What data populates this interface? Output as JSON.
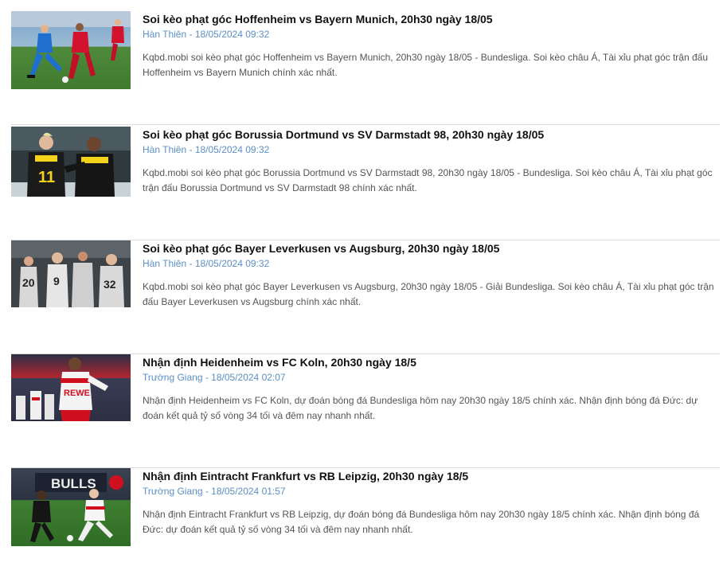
{
  "articles": [
    {
      "title": "Soi kèo phạt góc Hoffenheim vs Bayern Munich, 20h30 ngày 18/05",
      "author": "Hàn Thiên",
      "date": "18/05/2024 09:32",
      "excerpt": "Kqbd.mobi soi kèo phạt góc Hoffenheim vs Bayern Munich, 20h30 ngày 18/05 - Bundesliga. Soi kèo châu Á, Tài xỉu phạt góc trận đấu Hoffenheim vs Bayern Munich chính xác nhất.",
      "thumbnail": "hoffenheim-bayern-match-photo"
    },
    {
      "title": "Soi kèo phạt góc Borussia Dortmund vs SV Darmstadt 98, 20h30 ngày 18/05",
      "author": "Hàn Thiên",
      "date": "18/05/2024 09:32",
      "excerpt": "Kqbd.mobi soi kèo phạt góc Borussia Dortmund vs SV Darmstadt 98, 20h30 ngày 18/05 - Bundesliga. Soi kèo châu Á, Tài xỉu phạt góc trận đấu Borussia Dortmund vs SV Darmstadt 98 chính xác nhất.",
      "thumbnail": "dortmund-players-photo"
    },
    {
      "title": "Soi kèo phạt góc Bayer Leverkusen vs Augsburg, 20h30 ngày 18/05",
      "author": "Hàn Thiên",
      "date": "18/05/2024 09:32",
      "excerpt": "Kqbd.mobi soi kèo phạt góc Bayer Leverkusen vs Augsburg, 20h30 ngày 18/05 - Giải Bundesliga. Soi kèo châu Á, Tài xỉu phạt góc trận đấu Bayer Leverkusen vs Augsburg chính xác nhất.",
      "thumbnail": "leverkusen-celebration-photo"
    },
    {
      "title": "Nhận định Heidenheim vs FC Koln, 20h30 ngày 18/5",
      "author": "Trường Giang",
      "date": "18/05/2024 02:07",
      "excerpt": "Nhận định Heidenheim vs FC Koln, dự đoán bóng đá Bundesliga hôm nay 20h30 ngày 18/5 chính xác. Nhận định bóng đá Đức: dự đoán kết quả tỷ số vòng 34 tối và đêm nay nhanh nhất.",
      "thumbnail": "koln-player-photo"
    },
    {
      "title": "Nhận định Eintracht Frankfurt vs RB Leipzig, 20h30 ngày 18/5",
      "author": "Trường Giang",
      "date": "18/05/2024 01:57",
      "excerpt": "Nhận định Eintracht Frankfurt vs RB Leipzig, dự đoán bóng đá Bundesliga hôm nay 20h30 ngày 18/5 chính xác. Nhận định bóng đá Đức: dự đoán kết quả tỷ số vòng 34 tối và đêm nay nhanh nhất.",
      "thumbnail": "frankfurt-leipzig-match-photo"
    }
  ],
  "thumbnail_text": {
    "a2_shirt_number": "11",
    "a3_shirt_numbers": [
      "20",
      "9",
      "32"
    ],
    "a4_shirt_brand": "REWE",
    "a5_banner": "BULLS"
  },
  "colors": {
    "title": "#111111",
    "meta": "#5b8fc7",
    "excerpt": "#555555",
    "divider": "#dcdcdc"
  }
}
